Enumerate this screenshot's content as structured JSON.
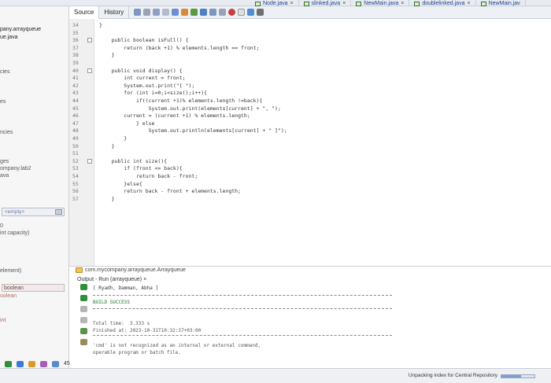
{
  "file_tabs": [
    {
      "label": "Node.java",
      "close": "×"
    },
    {
      "label": "slinked.java",
      "close": "×"
    },
    {
      "label": "NewMain.java",
      "close": "×"
    },
    {
      "label": "doublelinked.java",
      "close": "×"
    },
    {
      "label": "NewMain.jav",
      "close": ""
    }
  ],
  "editor_tabs": {
    "source": "Source",
    "history": "History"
  },
  "left_panel": {
    "items": [
      "pany.arrayqueue",
      "ue.java",
      "cies",
      "es",
      "ncies",
      "ges",
      "ompany.lab2",
      "ava",
      "0",
      "int capacity)",
      "element)",
      "-boolean",
      "oolean",
      "int"
    ],
    "empty_box": "<empty>",
    "boolean_box": "boolean"
  },
  "code": {
    "line_numbers": [
      "34",
      "35",
      "36",
      "37",
      "38",
      "39",
      "40",
      "41",
      "42",
      "43",
      "44",
      "45",
      "46",
      "47",
      "48",
      "49",
      "50",
      "51",
      "52",
      "53",
      "54",
      "55",
      "56",
      "57"
    ],
    "lines": [
      {
        "text": "}"
      },
      {
        "text": ""
      },
      {
        "text": "    public boolean isFull() {"
      },
      {
        "text": "        return (back +1) % elements.length == front;"
      },
      {
        "text": "    }"
      },
      {
        "text": ""
      },
      {
        "text": "    public void display() {"
      },
      {
        "text": "        int current = front;"
      },
      {
        "text": "        System.out.print(\"[ \");"
      },
      {
        "text": "        for (int i=0;i<size();i++){"
      },
      {
        "text": "            if((current +1)% elements.length !=back){"
      },
      {
        "text": "                System.out.print(elements[current] + \", \");"
      },
      {
        "text": "        current = (current +1) % elements.length;"
      },
      {
        "text": "            } else"
      },
      {
        "text": "                System.out.println(elements[current] + \" ]\");"
      },
      {
        "text": "        }"
      },
      {
        "text": "    }"
      },
      {
        "text": ""
      },
      {
        "text": "    public int size(){"
      },
      {
        "text": "        if (front <= back){"
      },
      {
        "text": "            return back - front;"
      },
      {
        "text": "        }else{"
      },
      {
        "text": "        return back - front + elements.length;"
      },
      {
        "text": "    }"
      }
    ]
  },
  "output": {
    "breadcrumb": "com.mycompany.arrayqueue.Arrayqueue",
    "header": "Output - Run (arrayqueue)",
    "header_close": "×",
    "lines": [
      "[ Ryadh, Damman, Abha ]",
      "BUILD SUCCESS",
      "Total time:  3.333 s",
      "Finished at: 2023-10-31T10:32:37+03:00",
      "'cmd' is not recognized as an internal or external command,",
      "operable program or batch file."
    ]
  },
  "status": {
    "task_text": "Unpacking index for Central Repository",
    "progress_fraction": 0.6,
    "taskbar_number": "45"
  },
  "colors": {
    "accent": "#1b3fb0",
    "keyword": "#1b3fb0",
    "string": "#b04a2a",
    "field": "#0a8a6a"
  }
}
